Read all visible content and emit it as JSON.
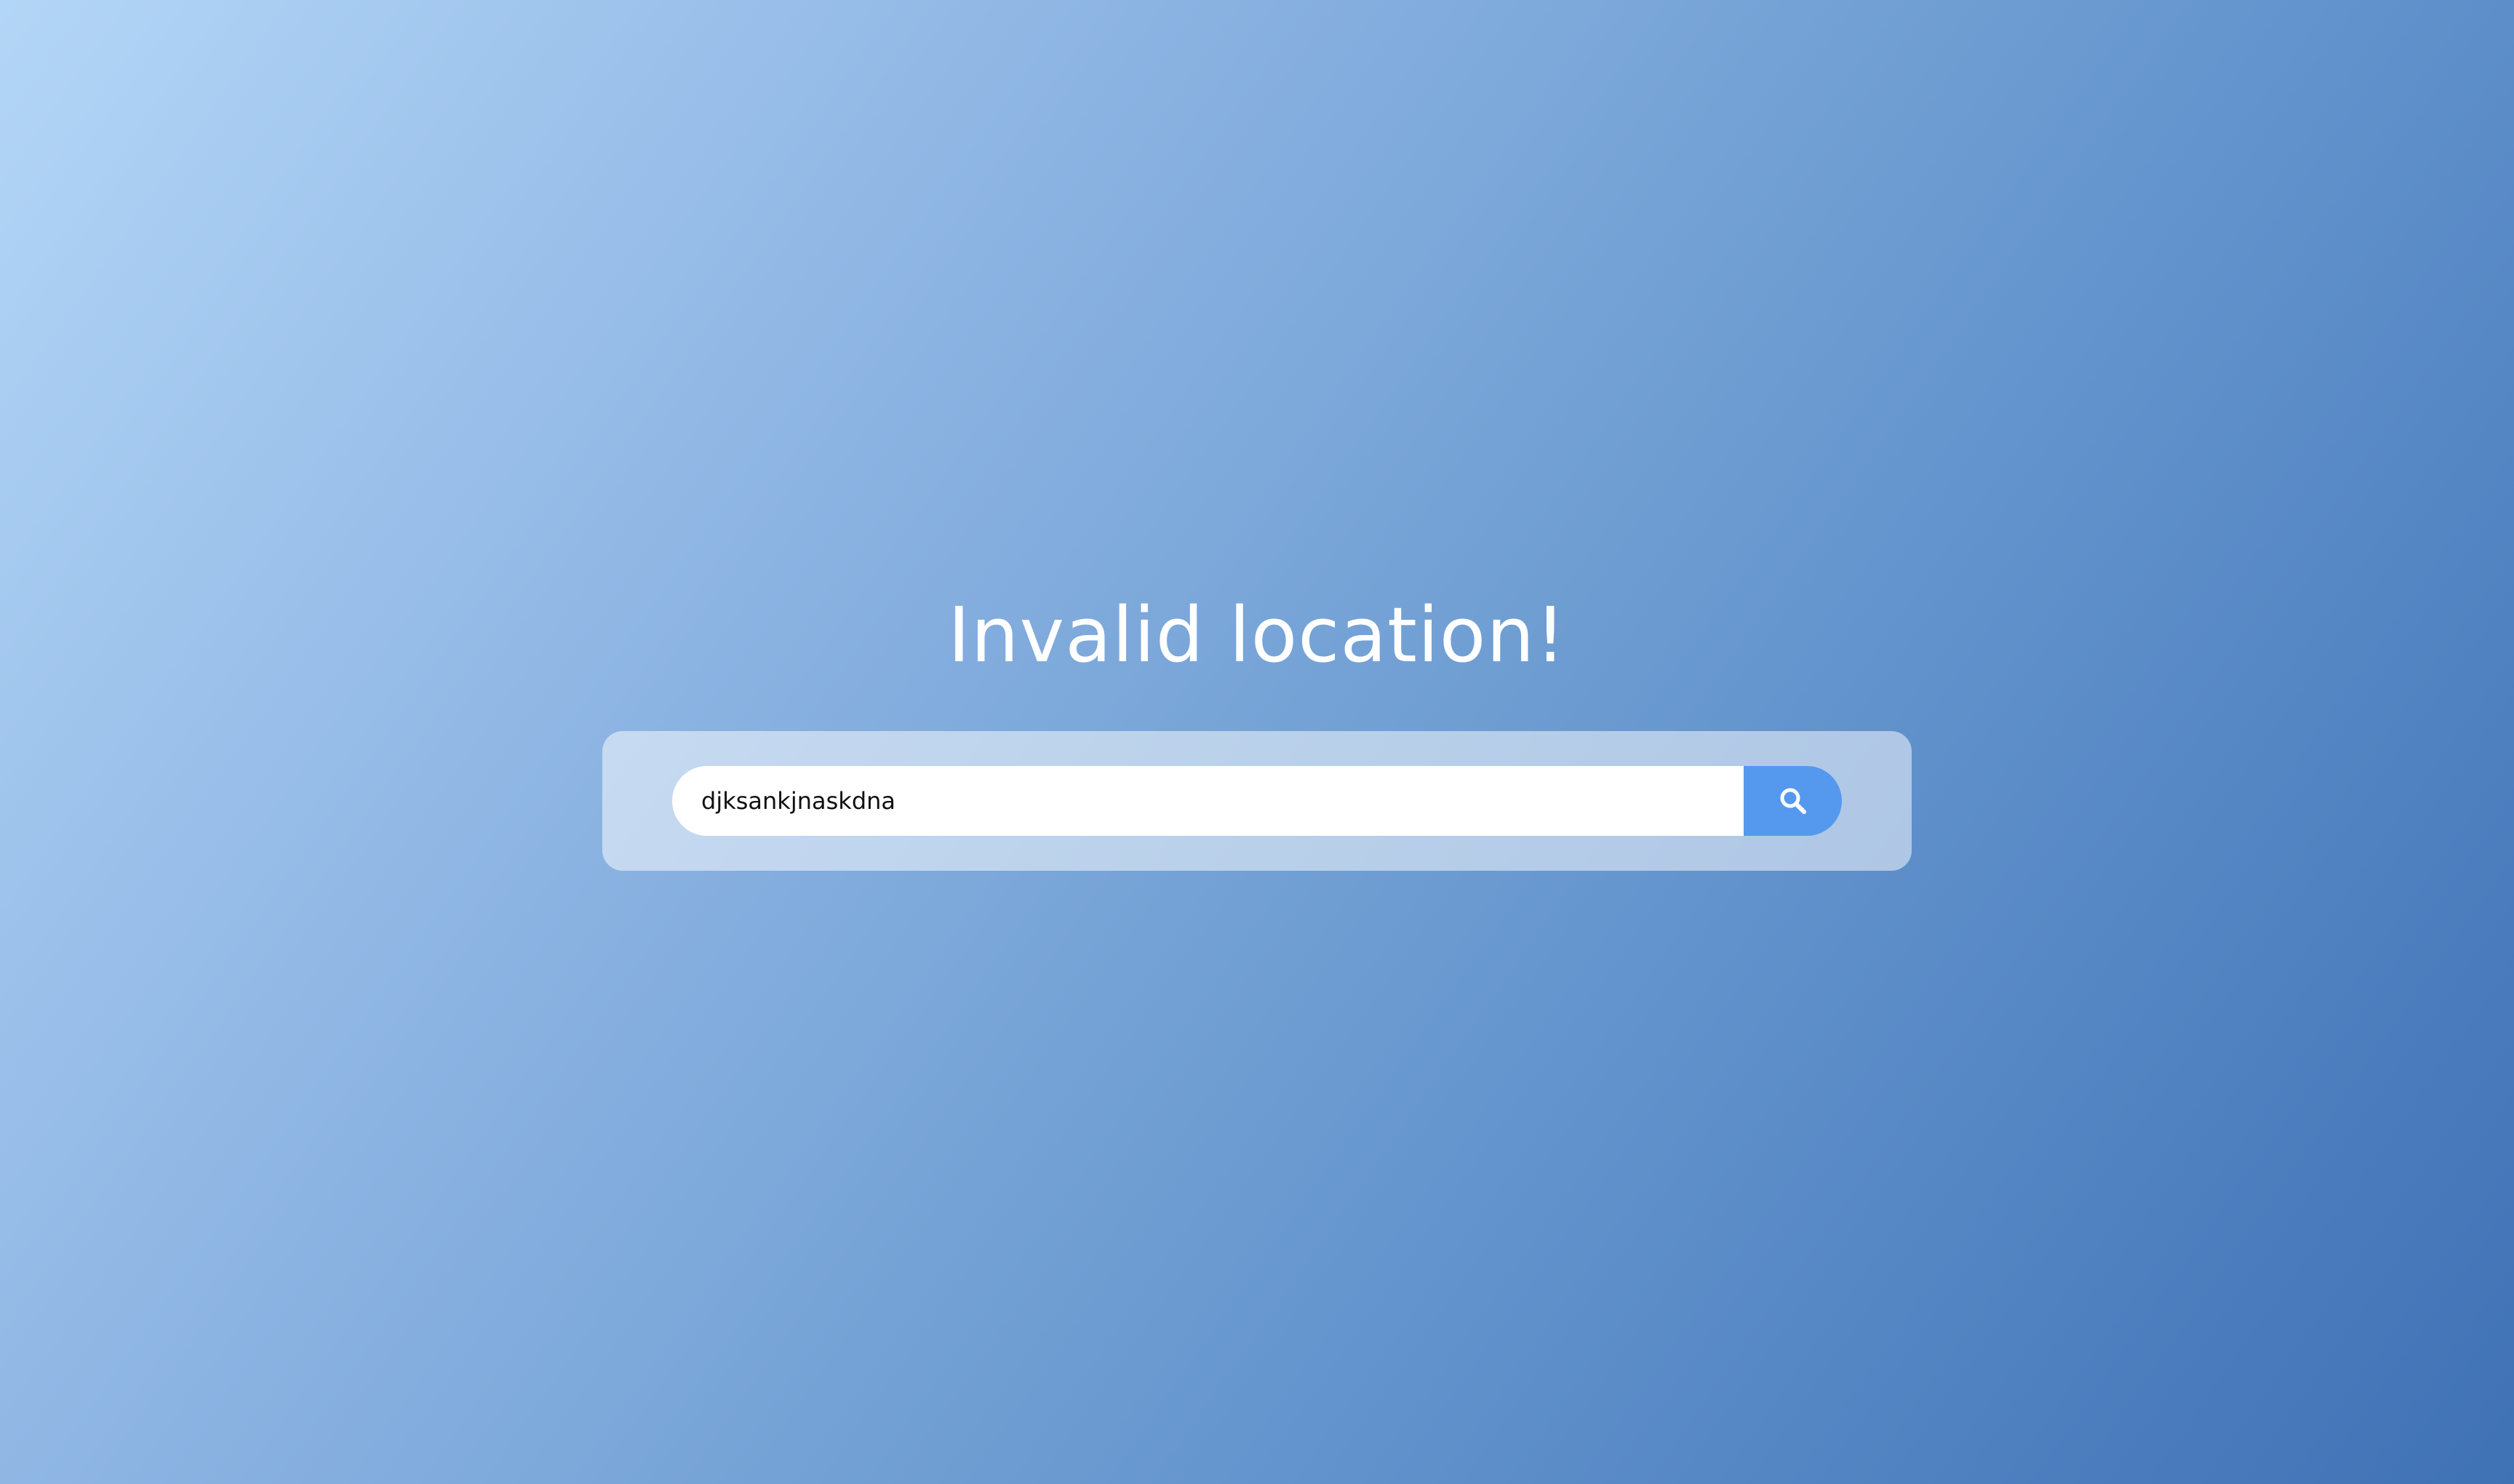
{
  "heading": "Invalid location!",
  "search": {
    "value": "djksankjnaskdna",
    "icon": "search-icon"
  },
  "colors": {
    "button": "#5599ef",
    "heading": "#ffffff"
  }
}
